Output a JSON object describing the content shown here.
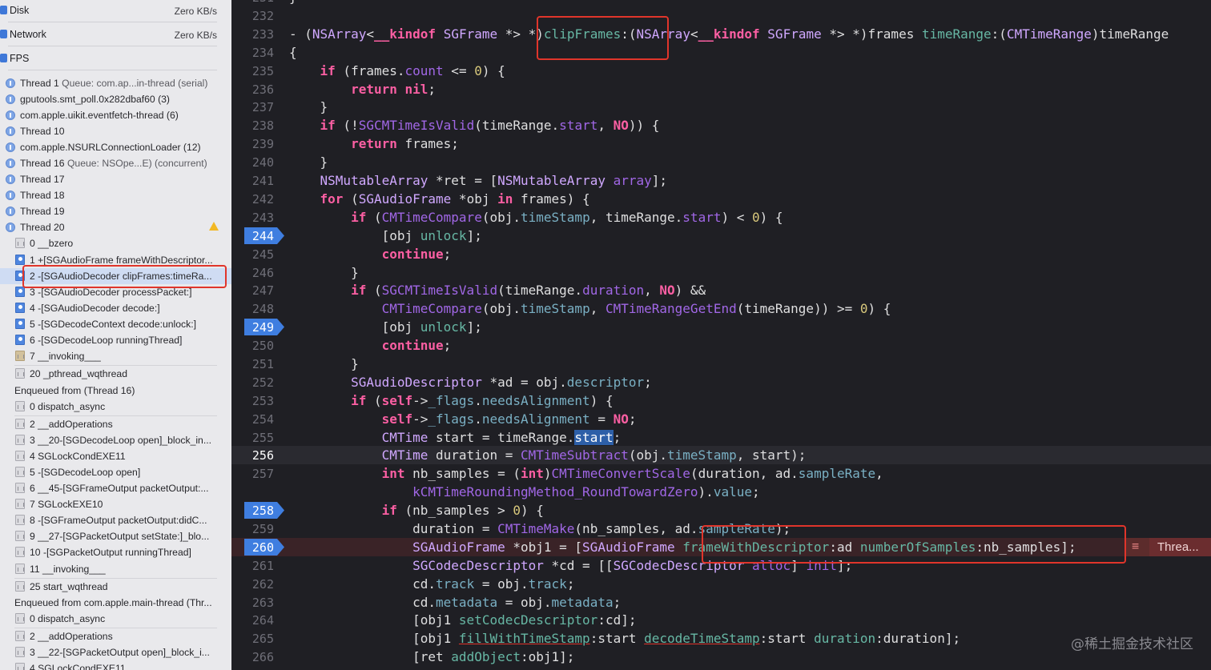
{
  "gauges": [
    {
      "label": "Disk",
      "value": "Zero KB/s"
    },
    {
      "label": "Network",
      "value": "Zero KB/s"
    },
    {
      "label": "FPS",
      "value": ""
    }
  ],
  "threads": [
    {
      "name": "Thread 1",
      "detail": "Queue: com.ap...in-thread (serial)"
    },
    {
      "name": "gputools.smt_poll.0x282dbaf60 (3)",
      "detail": ""
    },
    {
      "name": "com.apple.uikit.eventfetch-thread (6)",
      "detail": ""
    },
    {
      "name": "Thread 10",
      "detail": ""
    },
    {
      "name": "com.apple.NSURLConnectionLoader (12)",
      "detail": ""
    },
    {
      "name": "Thread 16",
      "detail": "Queue: NSOpe...E) (concurrent)"
    },
    {
      "name": "Thread 17",
      "detail": ""
    },
    {
      "name": "Thread 18",
      "detail": ""
    },
    {
      "name": "Thread 19",
      "detail": ""
    },
    {
      "name": "Thread 20",
      "detail": ""
    }
  ],
  "frames_thread20": [
    {
      "text": "0 __bzero",
      "kind": "sys"
    },
    {
      "text": "1 +[SGAudioFrame frameWithDescriptor...",
      "kind": "user"
    },
    {
      "text": "2 -[SGAudioDecoder clipFrames:timeRa...",
      "kind": "user",
      "selected": true
    },
    {
      "text": "3 -[SGAudioDecoder processPacket:]",
      "kind": "user"
    },
    {
      "text": "4 -[SGAudioDecoder decode:]",
      "kind": "user"
    },
    {
      "text": "5 -[SGDecodeContext decode:unlock:]",
      "kind": "user"
    },
    {
      "text": "6 -[SGDecodeLoop runningThread]",
      "kind": "user"
    },
    {
      "text": "7 __invoking___",
      "kind": "gear"
    },
    {
      "text": "20 _pthread_wqthread",
      "kind": "sys"
    }
  ],
  "enqueued1": {
    "title": "Enqueued from  (Thread 16)",
    "frames": [
      {
        "text": "0 dispatch_async",
        "kind": "sys"
      },
      {
        "text": "2 __addOperations",
        "kind": "sys"
      },
      {
        "text": "3 __20-[SGDecodeLoop open]_block_in...",
        "kind": "sys"
      },
      {
        "text": "4 SGLockCondEXE11",
        "kind": "sys"
      },
      {
        "text": "5 -[SGDecodeLoop open]",
        "kind": "sys"
      },
      {
        "text": "6 __45-[SGFrameOutput packetOutput:...",
        "kind": "sys"
      },
      {
        "text": "7 SGLockEXE10",
        "kind": "sys"
      },
      {
        "text": "8 -[SGFrameOutput packetOutput:didC...",
        "kind": "sys"
      },
      {
        "text": "9 __27-[SGPacketOutput setState:]_blo...",
        "kind": "sys"
      },
      {
        "text": "10 -[SGPacketOutput runningThread]",
        "kind": "sys"
      },
      {
        "text": "11 __invoking___",
        "kind": "sys"
      },
      {
        "text": "25 start_wqthread",
        "kind": "sys"
      }
    ]
  },
  "enqueued2": {
    "title": "Enqueued from com.apple.main-thread (Thr...",
    "frames": [
      {
        "text": "0 dispatch_async",
        "kind": "sys"
      },
      {
        "text": "2 __addOperations",
        "kind": "sys"
      },
      {
        "text": "3 __22-[SGPacketOutput open]_block_i...",
        "kind": "sys"
      },
      {
        "text": "4 SGLockCondEXE11",
        "kind": "sys"
      }
    ]
  },
  "editor": {
    "error_label": "Threa...",
    "watermark": "@稀土掘金技术社区"
  }
}
